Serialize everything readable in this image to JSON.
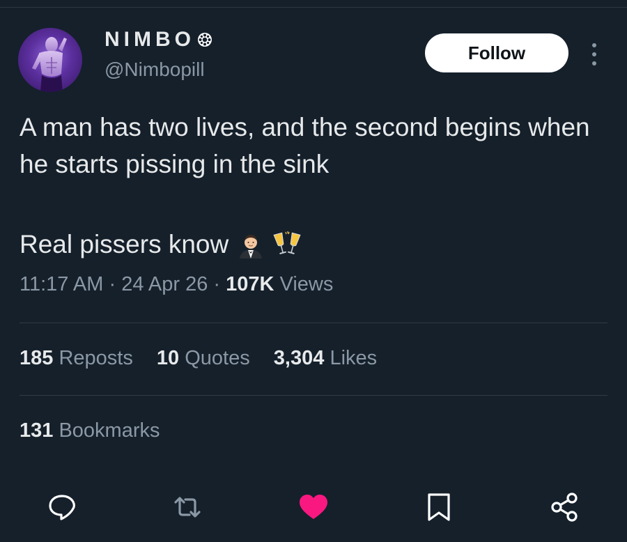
{
  "author": {
    "display_name": "NIMBO",
    "handle": "@Nimbopill",
    "badge_icon": "circle-badge-icon"
  },
  "follow_button": {
    "label": "Follow"
  },
  "tweet": {
    "text": "A man has two lives, and the second begins when he starts pissing in the sink",
    "line2": "Real pissers know",
    "emojis": [
      "man-in-tuxedo-emoji",
      "clinking-glasses-emoji"
    ]
  },
  "meta": {
    "time": "11:17 AM",
    "sep1": "·",
    "date": "24 Apr 26",
    "sep2": "·",
    "views_count": "107K",
    "views_label": "Views"
  },
  "stats": {
    "reposts_count": "185",
    "reposts_label": "Reposts",
    "quotes_count": "10",
    "quotes_label": "Quotes",
    "likes_count": "3,304",
    "likes_label": "Likes",
    "bookmarks_count": "131",
    "bookmarks_label": "Bookmarks"
  },
  "actions": [
    "reply-icon",
    "retweet-icon",
    "like-icon",
    "bookmark-icon",
    "share-icon"
  ],
  "colors": {
    "background": "#15202b",
    "text": "#e7e9ea",
    "muted": "#8b98a5",
    "like_active": "#f91880"
  }
}
